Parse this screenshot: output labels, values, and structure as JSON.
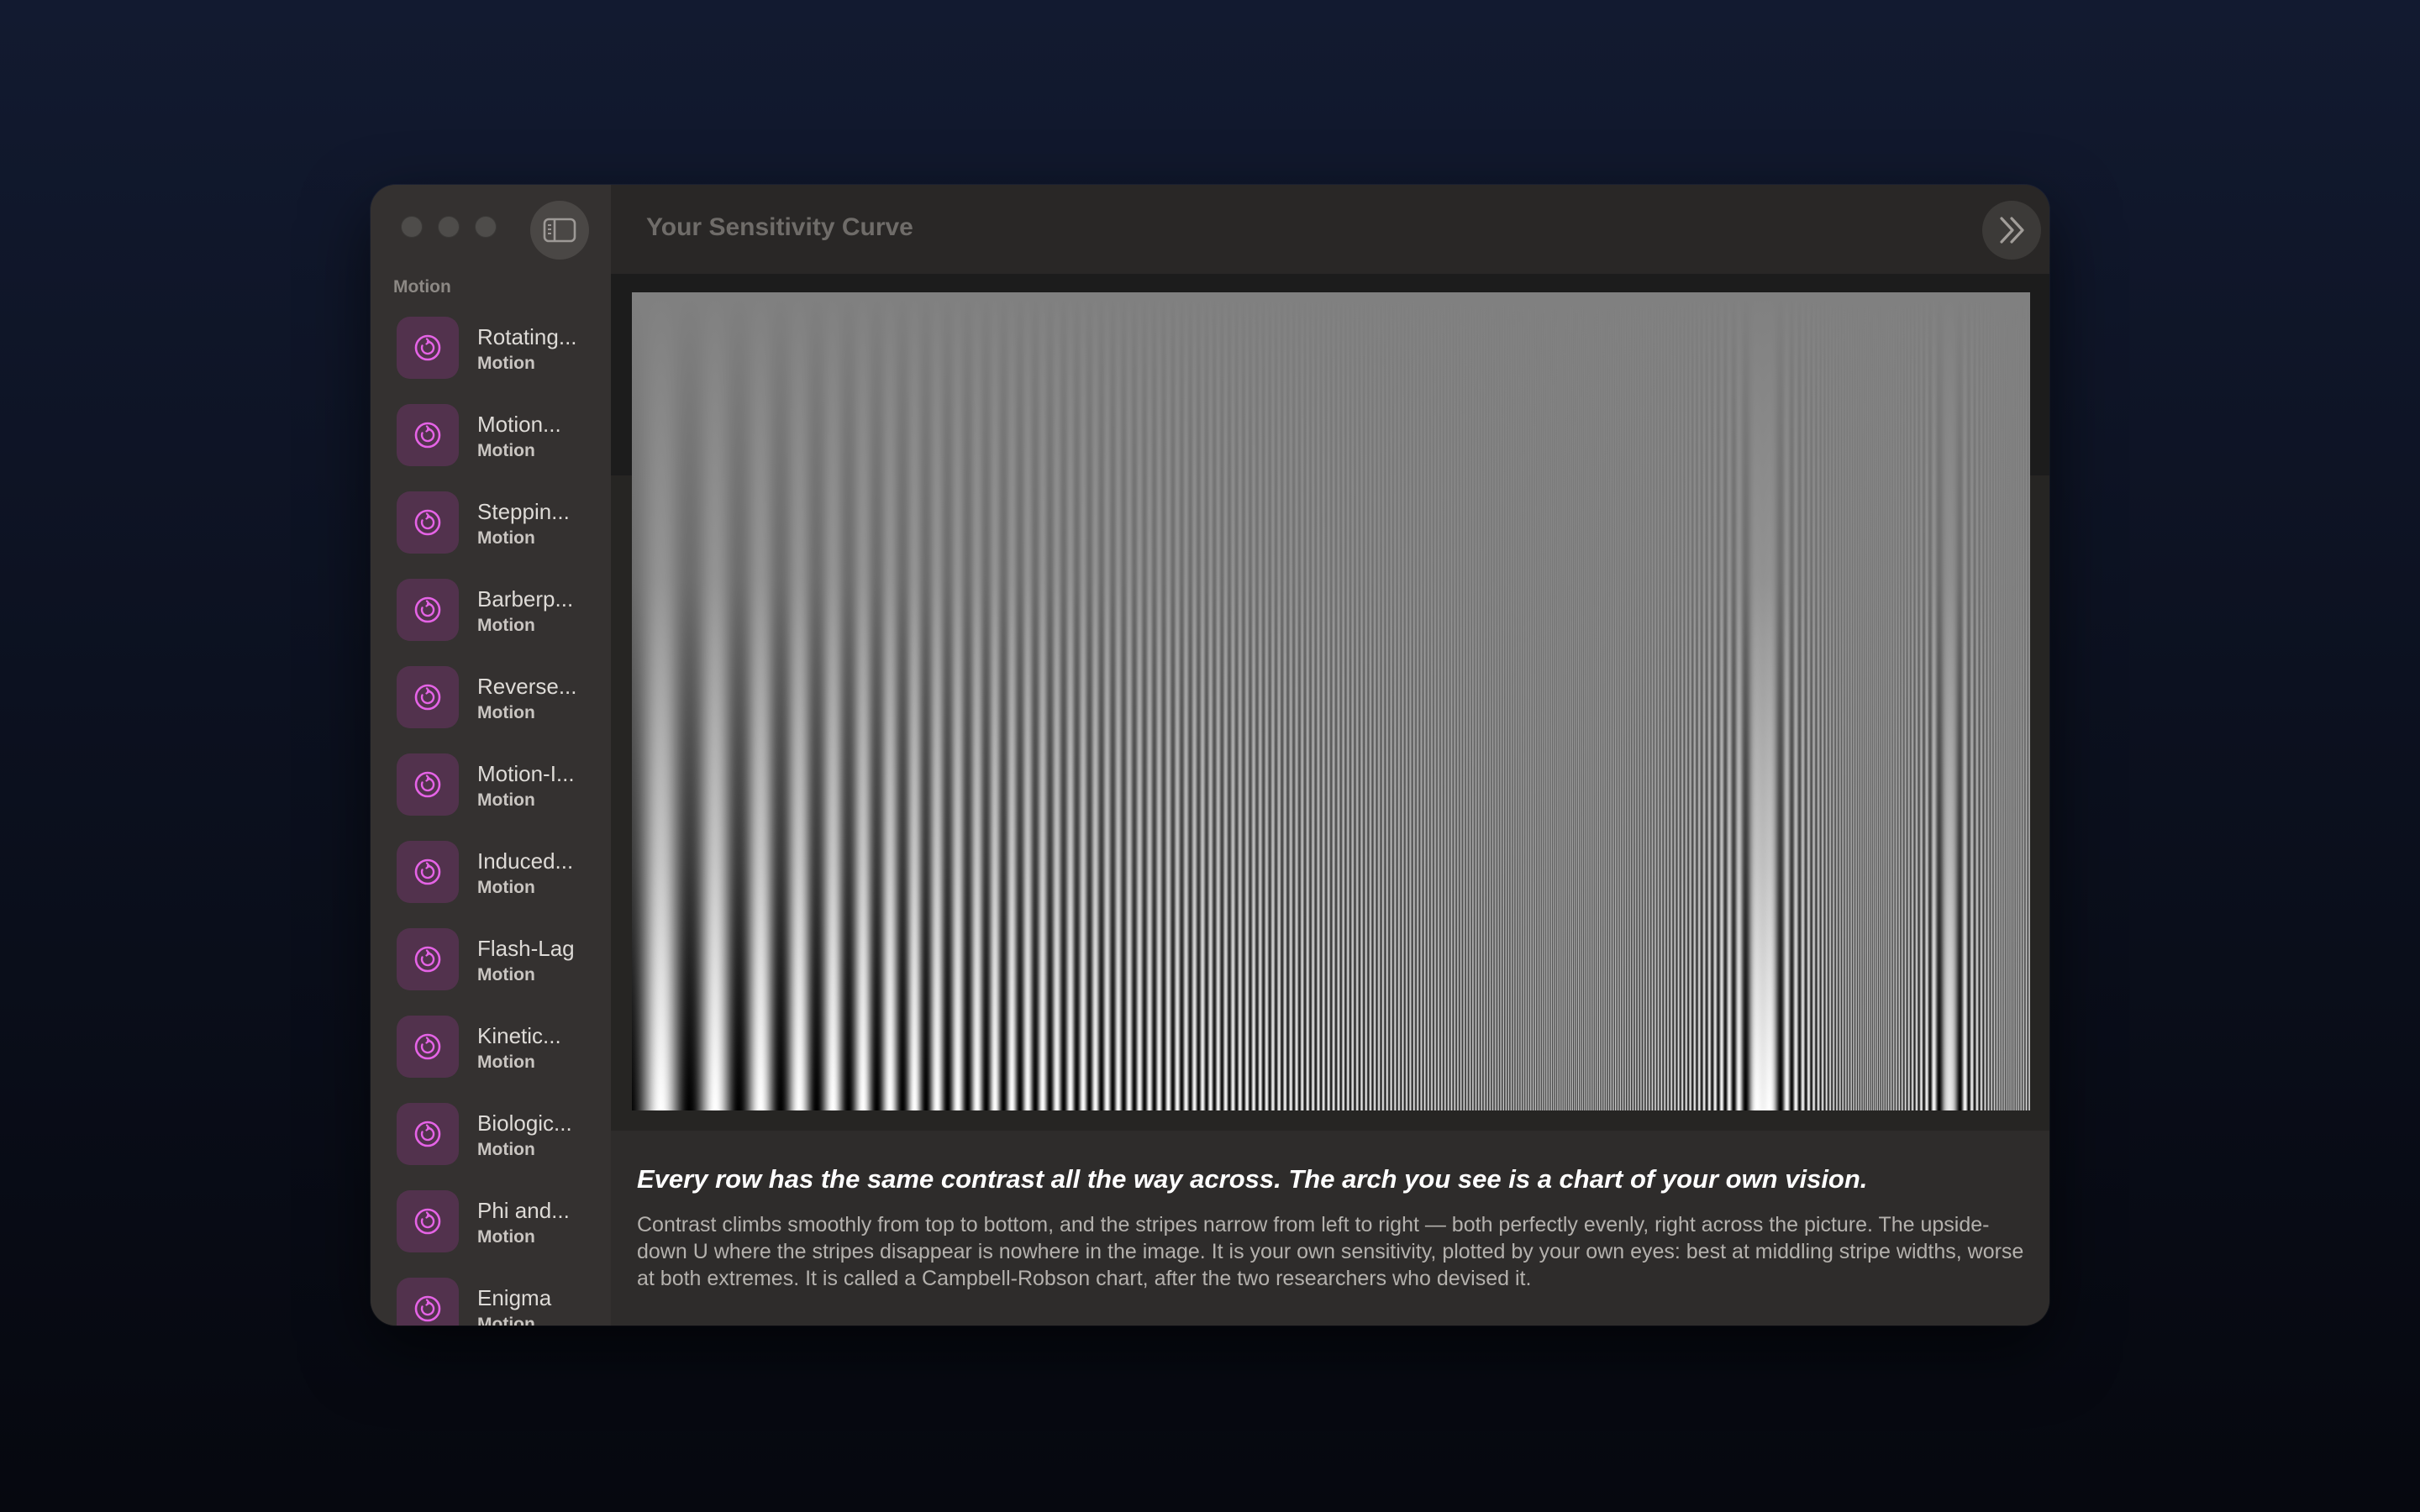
{
  "window": {
    "title": "Your Sensitivity Curve"
  },
  "sidebar": {
    "section_label": "Motion",
    "items": [
      {
        "title": "Rotating...",
        "subtitle": "Motion"
      },
      {
        "title": "Motion...",
        "subtitle": "Motion"
      },
      {
        "title": "Steppin...",
        "subtitle": "Motion"
      },
      {
        "title": "Barberp...",
        "subtitle": "Motion"
      },
      {
        "title": "Reverse...",
        "subtitle": "Motion"
      },
      {
        "title": "Motion-I...",
        "subtitle": "Motion"
      },
      {
        "title": "Induced...",
        "subtitle": "Motion"
      },
      {
        "title": "Flash-Lag",
        "subtitle": "Motion"
      },
      {
        "title": "Kinetic...",
        "subtitle": "Motion"
      },
      {
        "title": "Biologic...",
        "subtitle": "Motion"
      },
      {
        "title": "Phi and...",
        "subtitle": "Motion"
      },
      {
        "title": "Enigma",
        "subtitle": "Motion"
      }
    ],
    "icon": "rotate-icon"
  },
  "main": {
    "illusion_image": "campbell-robson-chart",
    "headline": "Every row has the same contrast all the way across. The arch you see is a chart of your own vision.",
    "body": "Contrast climbs smoothly from top to bottom, and the stripes narrow from left to right — both perfectly evenly, right across the picture. The upside-down U where the stripes disappear is nowhere in the image. It is your own sensitivity, plotted by your own eyes: best at middling stripe widths, worse at both extremes. It is called a Campbell-Robson chart, after the two researchers who devised it."
  },
  "colors": {
    "accent": "#e563e6",
    "icon_bg": "#52324d",
    "background_top": "#121a30",
    "background_bottom": "#06080f"
  }
}
